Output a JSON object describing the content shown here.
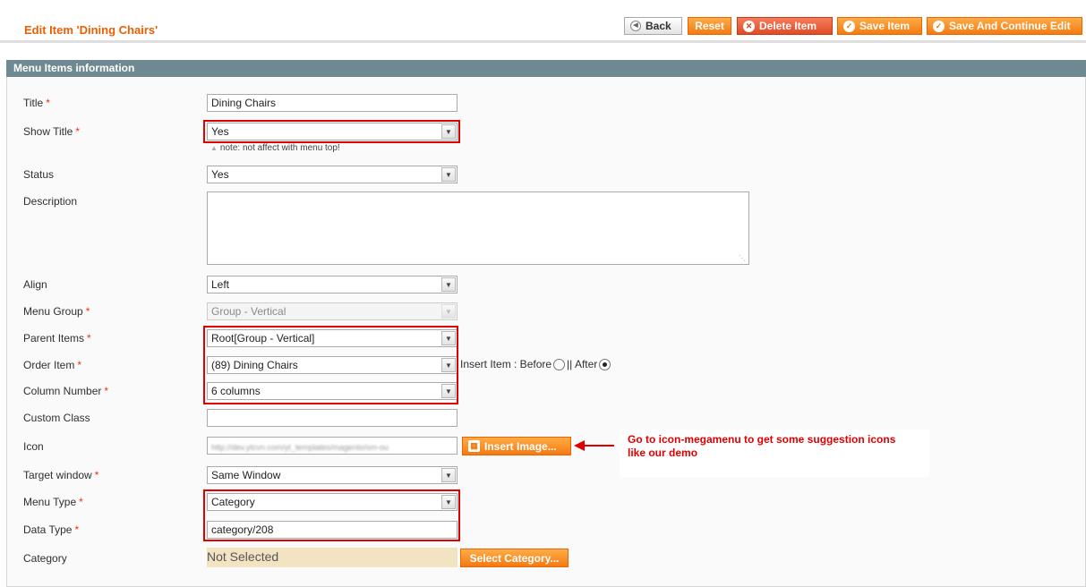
{
  "header": {
    "title": "Edit Item 'Dining Chairs'",
    "buttons": {
      "back": "Back",
      "reset": "Reset",
      "delete": "Delete Item",
      "save": "Save Item",
      "save_continue": "Save And Continue Edit"
    }
  },
  "section": {
    "title": "Menu Items information"
  },
  "form": {
    "title": {
      "label": "Title",
      "value": "Dining Chairs"
    },
    "show_title": {
      "label": "Show Title",
      "value": "Yes",
      "note": "note: not affect with menu top!"
    },
    "status": {
      "label": "Status",
      "value": "Yes"
    },
    "description": {
      "label": "Description",
      "value": ""
    },
    "align": {
      "label": "Align",
      "value": "Left"
    },
    "menu_group": {
      "label": "Menu Group",
      "value": "Group - Vertical"
    },
    "parent_items": {
      "label": "Parent Items",
      "value": "Root[Group - Vertical]"
    },
    "order_item": {
      "label": "Order Item",
      "value": "(89) Dining Chairs",
      "insert_label": "Insert Item : Before",
      "separator": "|| After"
    },
    "column_number": {
      "label": "Column Number",
      "value": "6 columns"
    },
    "custom_class": {
      "label": "Custom Class",
      "value": ""
    },
    "icon": {
      "label": "Icon",
      "value": "http://dev.ytcvn.com/yt_templates/magento/sm-ou",
      "button": "Insert Image..."
    },
    "target_window": {
      "label": "Target window",
      "value": "Same Window"
    },
    "menu_type": {
      "label": "Menu Type",
      "value": "Category"
    },
    "data_type": {
      "label": "Data Type",
      "value": "category/208"
    },
    "category": {
      "label": "Category",
      "value": "Not Selected",
      "button": "Select Category..."
    }
  },
  "annotation": {
    "line1": "Go to icon-megamenu to get some suggestion icons",
    "line2": "like our demo"
  },
  "colors": {
    "accent": "#eb5e00",
    "section": "#6f8992",
    "highlight": "#e00000"
  }
}
